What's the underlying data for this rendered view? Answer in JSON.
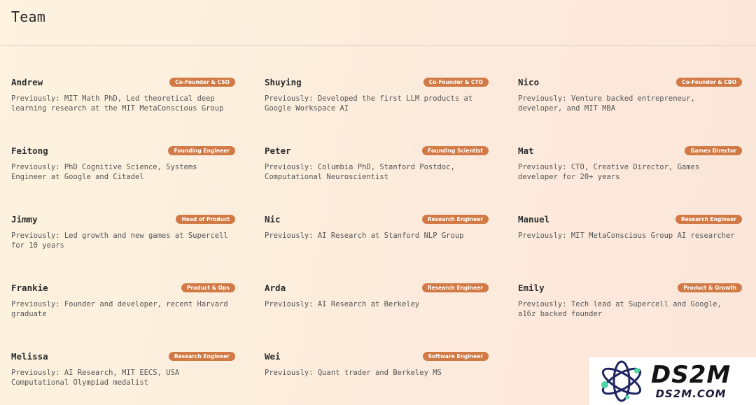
{
  "page": {
    "title": "Team"
  },
  "team": [
    {
      "name": "Andrew",
      "role": "Co-Founder & CSO",
      "bio": "Previously: MIT Math PhD, Led theoretical deep\nlearning research at the MIT MetaConscious Group"
    },
    {
      "name": "Shuying",
      "role": "Co-Founder & CTO",
      "bio": "Previously: Developed the first LLM products at\nGoogle Workspace AI"
    },
    {
      "name": "Nico",
      "role": "Co-Founder & CBO",
      "bio": "Previously: Venture backed entrepreneur,\ndeveloper, and MIT MBA"
    },
    {
      "name": "Feitong",
      "role": "Founding Engineer",
      "bio": "Previously: PhD Cognitive Science, Systems\nEngineer at Google and Citadel"
    },
    {
      "name": "Peter",
      "role": "Founding Scientist",
      "bio": "Previously: Columbia PhD, Stanford Postdoc,\nComputational Neuroscientist"
    },
    {
      "name": "Mat",
      "role": "Games Director",
      "bio": "Previously: CTO, Creative Director, Games\ndeveloper for 20+ years"
    },
    {
      "name": "Jimmy",
      "role": "Head of Product",
      "bio": "Previously: Led growth and new games at Supercell\nfor 10 years"
    },
    {
      "name": "Nic",
      "role": "Research Engineer",
      "bio": "Previously: AI Research at Stanford NLP Group"
    },
    {
      "name": "Manuel",
      "role": "Research Engineer",
      "bio": "Previously: MIT MetaConscious Group AI researcher"
    },
    {
      "name": "Frankie",
      "role": "Product & Ops",
      "bio": "Previously: Founder and developer, recent Harvard\ngraduate"
    },
    {
      "name": "Arda",
      "role": "Research Engineer",
      "bio": "Previously: AI Research at Berkeley"
    },
    {
      "name": "Emily",
      "role": "Product & Growth",
      "bio": "Previously: Tech lead at Supercell and Google,\na16z backed founder"
    },
    {
      "name": "Melissa",
      "role": "Research Engineer",
      "bio": "Previously: AI Research, MIT EECS, USA\nComputational Olympiad medalist"
    },
    {
      "name": "Wei",
      "role": "Software Engineer",
      "bio": "Previously: Quant trader and Berkeley MS"
    }
  ],
  "watermark": {
    "brand": "DS2M",
    "domain": "DS2M.COM"
  },
  "colors": {
    "badge": "#d27a45",
    "text": "#333333",
    "background": "#fdf3df"
  }
}
